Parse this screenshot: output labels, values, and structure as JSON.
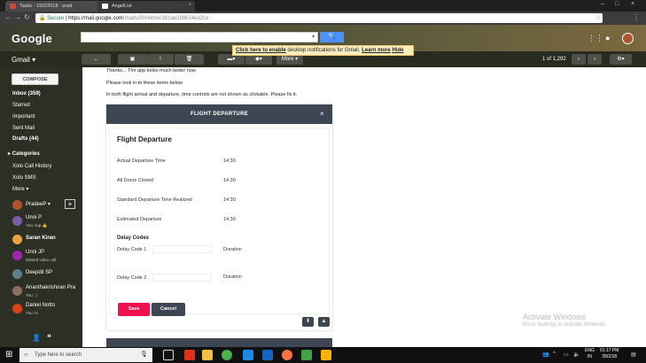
{
  "browser": {
    "tabs": [
      {
        "title": "Tasks - 19/2/2018 - prad",
        "icon": "gmail-icon"
      },
      {
        "title": "AngelList",
        "icon": "angellist-icon"
      }
    ],
    "window_controls": [
      "–",
      "□",
      "×"
    ],
    "address": {
      "secure_label": "Secure",
      "separator": "|",
      "url_host": "https://mail.google.com",
      "url_path": "/mail/u/0/#inbox/161ae398614ed2ce"
    }
  },
  "gmail": {
    "logo": "Google",
    "app_label": "Gmail ▾",
    "notification": {
      "link": "Click here to enable",
      "text": " desktop notifications for Gmail.",
      "learn_more": "Learn more",
      "hide": "Hide"
    },
    "toolbar": {
      "more_label": "More ▾",
      "pager": "1 of 1,292"
    },
    "compose_label": "COMPOSE",
    "nav": [
      {
        "label": "Inbox (359)",
        "bold": true
      },
      {
        "label": "Starred",
        "bold": false
      },
      {
        "label": "Important",
        "bold": false
      },
      {
        "label": "Sent Mail",
        "bold": false
      },
      {
        "label": "Drafts (44)",
        "bold": true
      }
    ],
    "categories_label": "Categories",
    "labels": [
      "Xolo Call History",
      "Xolo SMS",
      "More ▾"
    ],
    "hangouts_user": "PradeeP ▾",
    "contacts": [
      {
        "name": "Unni P",
        "status": "You: sup 👍",
        "color": "#7b5ea7"
      },
      {
        "name": "Saran Kiran",
        "status": "",
        "color": "#e8a33b"
      },
      {
        "name": "Unni JP",
        "status": "Missed video call",
        "color": "#9c27b0"
      },
      {
        "name": "Deepdil SP",
        "status": "",
        "color": "#607d8b"
      },
      {
        "name": "Ananthakrishnan Pra",
        "status": "You: :)",
        "color": "#8d6e63"
      },
      {
        "name": "Daniel Notto",
        "status": "You: hi",
        "color": "#d84315"
      }
    ]
  },
  "email": {
    "line1": "Thanks... The app looks much better now",
    "line2": "Please look in to these items below",
    "line3": "In both flight arrival and departure, time controls are not shown as clickable. Please fix it."
  },
  "app_screenshot": {
    "header": "FLIGHT DEPARTURE",
    "card_title": "Flight Departure",
    "rows": [
      {
        "label": "Actual Departure Time",
        "value": "14:30"
      },
      {
        "label": "All Doors Closed",
        "value": "14:30"
      },
      {
        "label": "Standard Departure Time Realized",
        "value": "14:30"
      },
      {
        "label": "Estimated Departure",
        "value": "14:30"
      }
    ],
    "delay_heading": "Delay Codes",
    "delay_rows": [
      {
        "label": "Delay Code 1",
        "duration": "Duration"
      },
      {
        "label": "Delay Code 2",
        "duration": "Duration"
      }
    ],
    "save_label": "Save",
    "cancel_label": "Cancel"
  },
  "watermark": {
    "title": "Activate Windows",
    "subtitle": "Go to Settings to activate Windows."
  },
  "taskbar": {
    "search_placeholder": "Type here to search",
    "lang_top": "ENG",
    "lang_bottom": "IN",
    "time": "01:17 PM",
    "date": "28/2/18"
  }
}
